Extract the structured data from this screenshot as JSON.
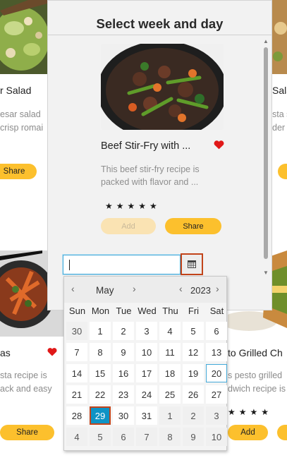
{
  "background_cards": [
    {
      "title": "r Salad",
      "desc": [
        "esar salad",
        "crisp romai"
      ],
      "share": "Share"
    },
    {
      "title": "Sala",
      "desc": [
        "sta s",
        "der p"
      ]
    },
    {
      "title": "as",
      "desc": [
        "sta recipe is",
        "ack and easy"
      ],
      "share": "Share"
    },
    {
      "title": "to Grilled Ch",
      "desc": [
        "s pesto grilled",
        "dwich recipe is"
      ],
      "add": "Add",
      "stars": "★★★★"
    }
  ],
  "modal": {
    "title": "Select week and day",
    "recipe": {
      "title": "Beef Stir-Fry with ...",
      "description": [
        "This beef stir-fry recipe is",
        "packed with flavor and ..."
      ],
      "stars": "★★★★★",
      "add_label": "Add",
      "share_label": "Share"
    },
    "date_input": {
      "value": ""
    },
    "icons": {
      "calendar": "calendar-icon",
      "favorite": "heart-icon"
    },
    "colors": {
      "accent": "#fcc02d",
      "selected": "#0e93c5",
      "heart": "#e01818"
    }
  },
  "date_picker": {
    "month": "May",
    "year": "2023",
    "weekdays": [
      "Sun",
      "Mon",
      "Tue",
      "Wed",
      "Thu",
      "Fri",
      "Sat"
    ],
    "weeks": [
      [
        "30",
        "1",
        "2",
        "3",
        "4",
        "5",
        "6"
      ],
      [
        "7",
        "8",
        "9",
        "10",
        "11",
        "12",
        "13"
      ],
      [
        "14",
        "15",
        "16",
        "17",
        "18",
        "19",
        "20"
      ],
      [
        "21",
        "22",
        "23",
        "24",
        "25",
        "26",
        "27"
      ],
      [
        "28",
        "29",
        "30",
        "31",
        "1",
        "2",
        "3"
      ],
      [
        "4",
        "5",
        "6",
        "7",
        "8",
        "9",
        "10"
      ]
    ],
    "selected": "29",
    "today": "20"
  }
}
